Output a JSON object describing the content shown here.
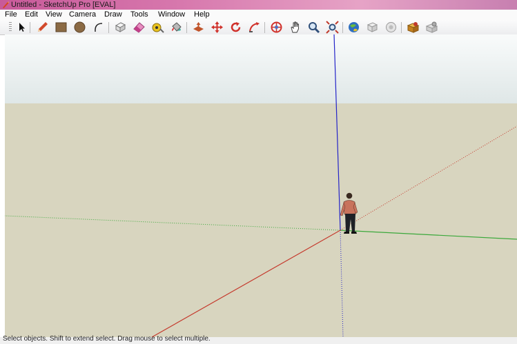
{
  "window": {
    "title": "Untitled - SketchUp Pro [EVAL]"
  },
  "menu": [
    "File",
    "Edit",
    "View",
    "Camera",
    "Draw",
    "Tools",
    "Window",
    "Help"
  ],
  "toolbar": {
    "tools": [
      {
        "name": "select-tool",
        "icon": "arrow-cursor-icon"
      },
      {
        "name": "line-tool",
        "icon": "pencil-icon"
      },
      {
        "name": "rectangle-tool",
        "icon": "rectangle-icon"
      },
      {
        "name": "circle-tool",
        "icon": "circle-icon"
      },
      {
        "name": "arc-tool",
        "icon": "arc-icon"
      },
      {
        "name": "make-component-tool",
        "icon": "component-icon"
      },
      {
        "name": "eraser-tool",
        "icon": "eraser-icon"
      },
      {
        "name": "tape-measure-tool",
        "icon": "tape-measure-icon"
      },
      {
        "name": "paint-bucket-tool",
        "icon": "paint-bucket-icon"
      },
      {
        "name": "push-pull-tool",
        "icon": "push-pull-icon"
      },
      {
        "name": "move-tool",
        "icon": "move-icon"
      },
      {
        "name": "rotate-tool",
        "icon": "rotate-icon"
      },
      {
        "name": "follow-me-tool",
        "icon": "follow-me-icon"
      },
      {
        "name": "orbit-tool",
        "icon": "orbit-icon"
      },
      {
        "name": "pan-tool",
        "icon": "hand-icon"
      },
      {
        "name": "zoom-tool",
        "icon": "magnifier-icon"
      },
      {
        "name": "zoom-extents-tool",
        "icon": "zoom-extents-icon"
      },
      {
        "name": "get-models-tool",
        "icon": "globe-icon"
      },
      {
        "name": "share-model-tool",
        "icon": "share-model-icon"
      },
      {
        "name": "share-component-tool",
        "icon": "share-component-icon"
      },
      {
        "name": "extension-warehouse-tool",
        "icon": "extension-box-icon"
      },
      {
        "name": "extension-manager-tool",
        "icon": "extension-gear-icon"
      }
    ]
  },
  "colors": {
    "sky_top": "#f9fbfb",
    "sky_bottom": "#dfe7e7",
    "ground": "#d8d5bf",
    "axis_red": "#c53a2d",
    "axis_green": "#3aa83a",
    "axis_blue": "#2323c8"
  },
  "status": {
    "text": "Select objects. Shift to extend select. Drag mouse to select multiple."
  }
}
